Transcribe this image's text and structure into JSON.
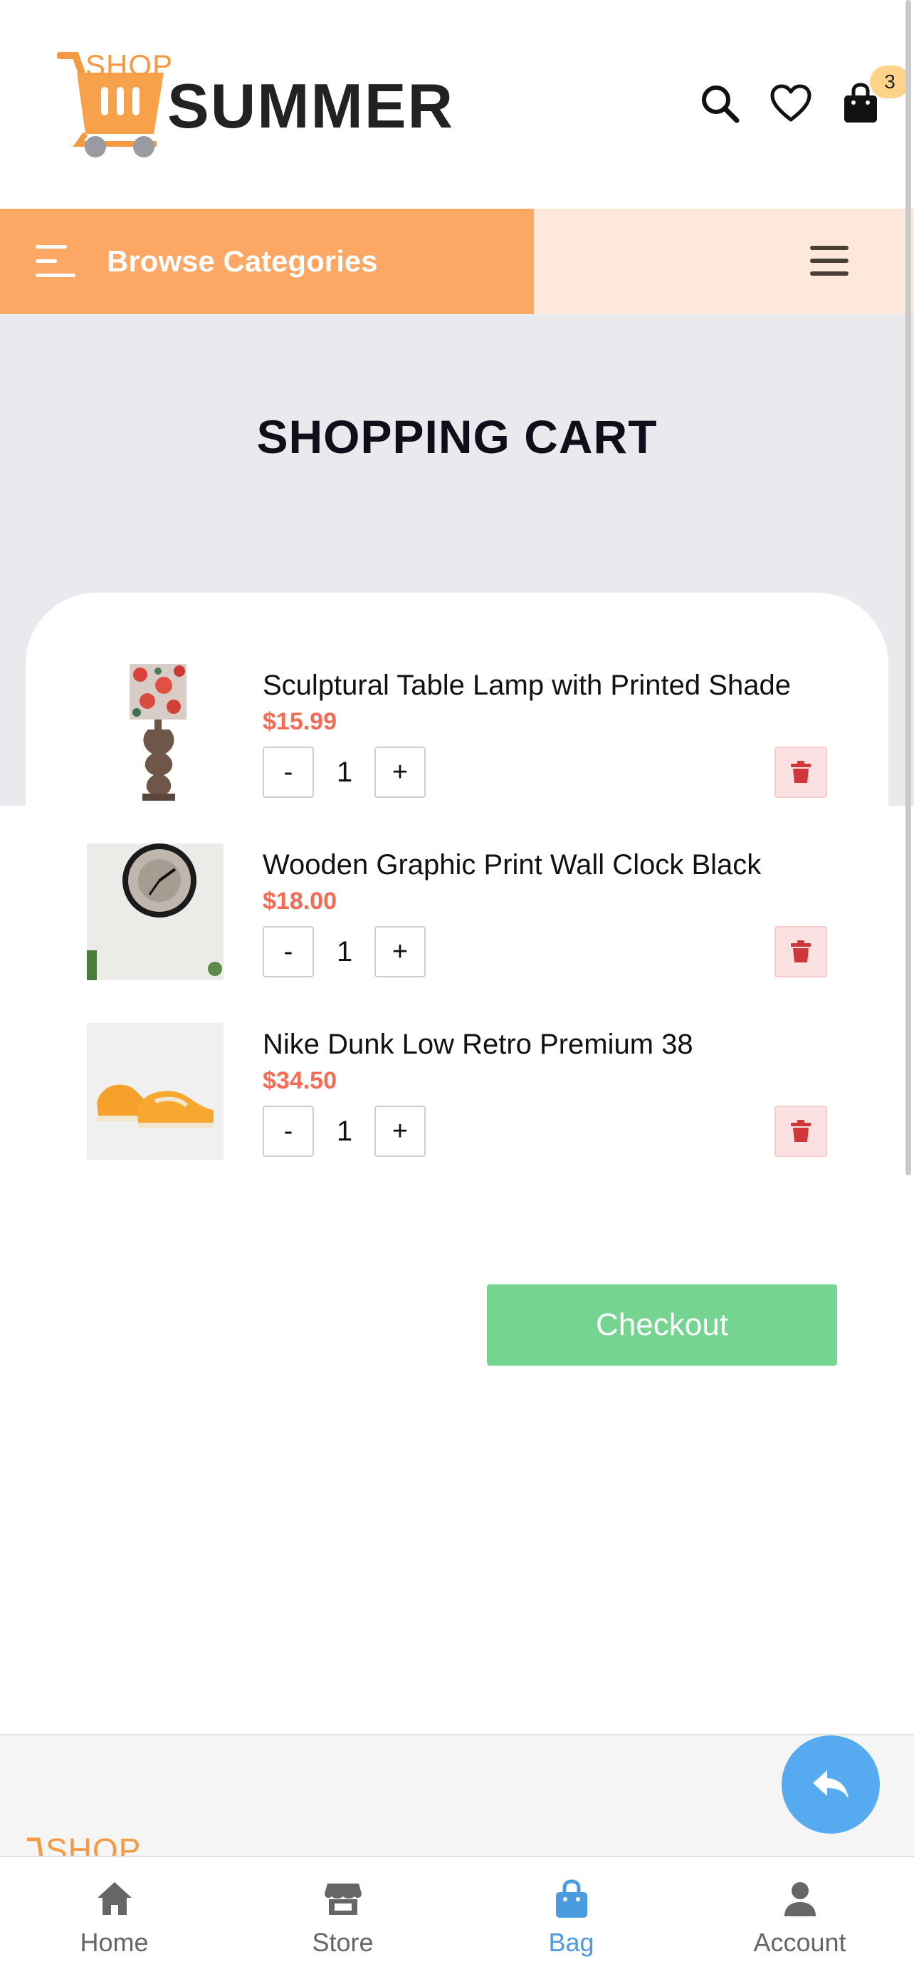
{
  "header": {
    "logo_shop": "SHOP",
    "logo_summer": "SUMMER",
    "cart_count": "3",
    "icons": [
      "search-icon",
      "heart-icon",
      "shopping-bag-icon"
    ]
  },
  "category_bar": {
    "browse_label": "Browse Categories"
  },
  "page": {
    "title": "SHOPPING CART"
  },
  "cart": {
    "items": [
      {
        "name": "Sculptural Table Lamp with Printed Shade",
        "price": "$15.99",
        "quantity": "1",
        "image": "table-lamp-image"
      },
      {
        "name": "Wooden Graphic Print Wall Clock Black",
        "price": "$18.00",
        "quantity": "1",
        "image": "wall-clock-image"
      },
      {
        "name": "Nike Dunk Low Retro Premium 38",
        "price": "$34.50",
        "quantity": "1",
        "image": "sneaker-image"
      }
    ],
    "minus_label": "-",
    "plus_label": "+",
    "checkout_label": "Checkout"
  },
  "footer": {
    "logo_shop": "SHOP"
  },
  "bottom_nav": {
    "items": [
      {
        "label": "Home",
        "icon": "home-icon"
      },
      {
        "label": "Store",
        "icon": "store-icon"
      },
      {
        "label": "Bag",
        "icon": "bag-icon",
        "active": true
      },
      {
        "label": "Account",
        "icon": "account-icon"
      }
    ]
  },
  "colors": {
    "accent_orange": "#fda765",
    "price_red": "#f56b53",
    "checkout_green": "#75d590",
    "active_blue": "#4a9be0"
  }
}
